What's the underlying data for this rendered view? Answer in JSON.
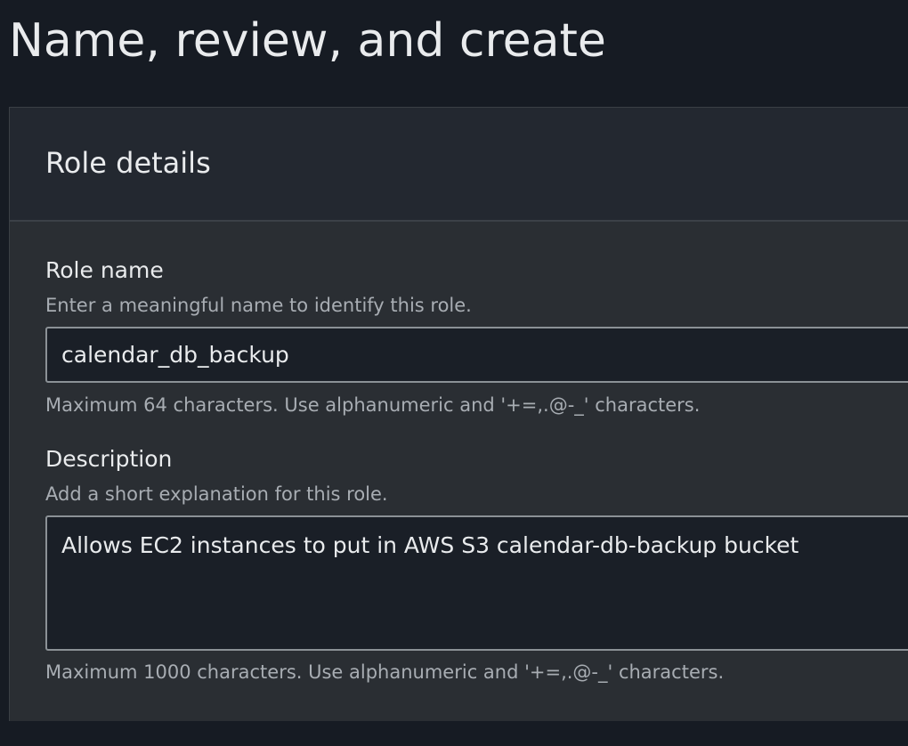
{
  "page": {
    "title": "Name, review, and create"
  },
  "role_details": {
    "title": "Role details",
    "role_name": {
      "label": "Role name",
      "description": "Enter a meaningful name to identify this role.",
      "value": "calendar_db_backup",
      "constraint": "Maximum 64 characters. Use alphanumeric and '+=,.@-_' characters."
    },
    "description": {
      "label": "Description",
      "description": "Add a short explanation for this role.",
      "value": "Allows EC2 instances to put in AWS S3 calendar-db-backup bucket",
      "constraint": "Maximum 1000 characters. Use alphanumeric and '+=,.@-_' characters."
    }
  },
  "colors": {
    "background": "#161b23",
    "panel": "#2a2e33",
    "panel_header": "#232830",
    "input_background": "#1a1f27",
    "input_border": "#8b9196",
    "text_primary": "#e9ebed",
    "text_secondary": "#a8adb3"
  }
}
